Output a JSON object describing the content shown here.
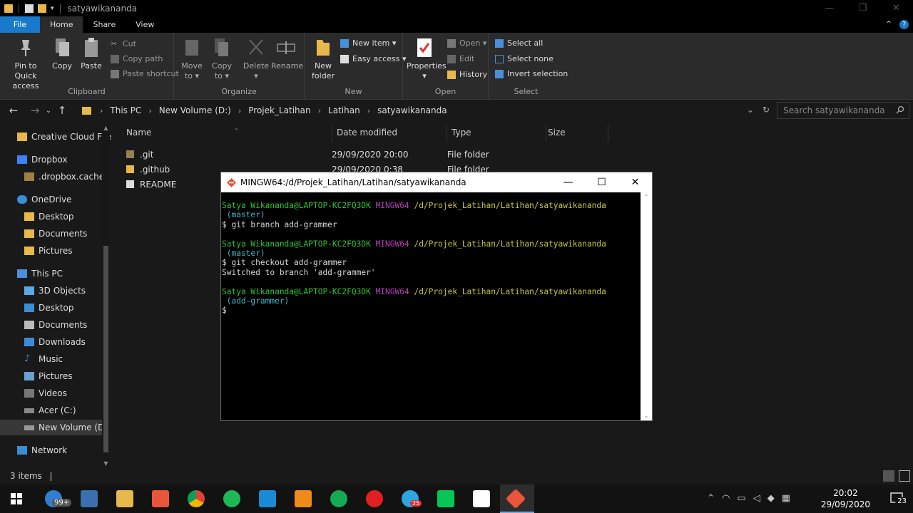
{
  "window": {
    "title": "satyawikananda"
  },
  "ribbon_tabs": [
    {
      "label": "File"
    },
    {
      "label": "Home"
    },
    {
      "label": "Share"
    },
    {
      "label": "View"
    }
  ],
  "ribbon": {
    "clipboard": {
      "label": "Clipboard",
      "pin_line1": "Pin to Quick",
      "pin_line2": "access",
      "copy": "Copy",
      "paste": "Paste",
      "cut": "Cut",
      "copy_path": "Copy path",
      "paste_shortcut": "Paste shortcut"
    },
    "organize": {
      "label": "Organize",
      "move_to": "Move",
      "move_to_2": "to ▾",
      "copy_to": "Copy",
      "copy_to_2": "to ▾",
      "delete": "Delete",
      "delete_2": "▾",
      "rename": "Rename"
    },
    "new": {
      "label": "New",
      "new_folder": "New",
      "new_folder_2": "folder",
      "new_item": "New item ▾",
      "easy_access": "Easy access ▾"
    },
    "open": {
      "label": "Open",
      "properties": "Properties",
      "properties_2": "▾",
      "open": "Open ▾",
      "edit": "Edit",
      "history": "History"
    },
    "select": {
      "label": "Select",
      "select_all": "Select all",
      "select_none": "Select none",
      "invert": "Invert selection"
    }
  },
  "address": {
    "crumbs": [
      "This PC",
      "New Volume (D:)",
      "Projek_Latihan",
      "Latihan",
      "satyawikananda"
    ],
    "search_placeholder": "Search satyawikananda"
  },
  "nav_pane": {
    "items": [
      {
        "label": "Creative Cloud File"
      },
      {
        "label": "Dropbox"
      },
      {
        "label": ".dropbox.cache"
      },
      {
        "label": "OneDrive"
      },
      {
        "label": "Desktop"
      },
      {
        "label": "Documents"
      },
      {
        "label": "Pictures"
      },
      {
        "label": "This PC"
      },
      {
        "label": "3D Objects"
      },
      {
        "label": "Desktop"
      },
      {
        "label": "Documents"
      },
      {
        "label": "Downloads"
      },
      {
        "label": "Music"
      },
      {
        "label": "Pictures"
      },
      {
        "label": "Videos"
      },
      {
        "label": "Acer (C:)"
      },
      {
        "label": "New Volume (D:)"
      },
      {
        "label": "Network"
      }
    ]
  },
  "file_list": {
    "columns": [
      "Name",
      "Date modified",
      "Type",
      "Size"
    ],
    "rows": [
      {
        "name": ".git",
        "date": "29/09/2020 20:00",
        "type": "File folder"
      },
      {
        "name": ".github",
        "date": "29/09/2020 0:38",
        "type": "File folder"
      },
      {
        "name": "README",
        "date": "",
        "type": ""
      }
    ]
  },
  "status": {
    "count": "3 items"
  },
  "terminal": {
    "title": "MINGW64:/d/Projek_Latihan/Latihan/satyawikananda",
    "user": "Satya Wikananda@LAPTOP-KC2FQ3DK",
    "env": "MINGW64",
    "path": "/d/Projek_Latihan/Latihan/satyawikananda",
    "branch1": " (master)",
    "cmd1": "$ git branch add-grammer",
    "branch2": " (master)",
    "cmd2": "$ git checkout add-grammer",
    "out2": "Switched to branch 'add-grammer'",
    "branch3": " (add-grammer)",
    "prompt": "$"
  },
  "taskbar": {
    "mail_badge": "99+",
    "telegram_badge": "25",
    "clock_time": "20:02",
    "clock_date": "29/09/2020",
    "notif_count": "23"
  }
}
